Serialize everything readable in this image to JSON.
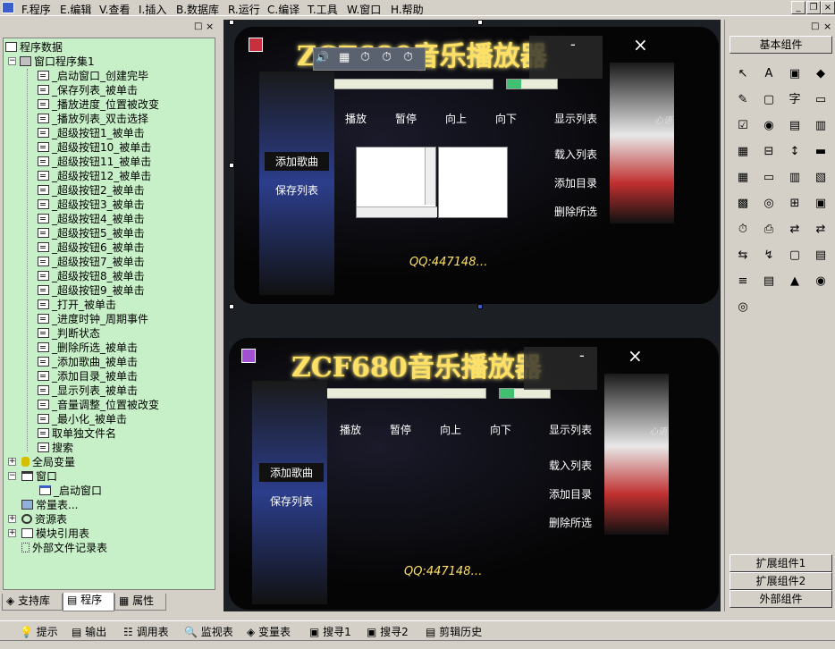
{
  "menu": [
    "F.程序",
    "E.编辑",
    "V.查看",
    "I.插入",
    "B.数据库",
    "R.运行",
    "C.编译",
    "T.工具",
    "W.窗口",
    "H.帮助"
  ],
  "tree": {
    "root": "程序数据",
    "set": "窗口程序集1",
    "subs": [
      "_启动窗口_创建完毕",
      "_保存列表_被单击",
      "_播放进度_位置被改变",
      "_播放列表_双击选择",
      "_超级按钮1_被单击",
      "_超级按钮10_被单击",
      "_超级按钮11_被单击",
      "_超级按钮12_被单击",
      "_超级按钮2_被单击",
      "_超级按钮3_被单击",
      "_超级按钮4_被单击",
      "_超级按钮5_被单击",
      "_超级按钮6_被单击",
      "_超级按钮7_被单击",
      "_超级按钮8_被单击",
      "_超级按钮9_被单击",
      "_打开_被单击",
      "_进度时钟_周期事件",
      "_判断状态",
      "_删除所选_被单击",
      "_添加歌曲_被单击",
      "_添加目录_被单击",
      "_显示列表_被单击",
      "_音量调整_位置被改变",
      "_最小化_被单击",
      "取单独文件名",
      "搜索"
    ],
    "global": "全局变量",
    "window": "窗口",
    "startwin": "_启动窗口",
    "constants": "常量表...",
    "resources": "资源表",
    "modules": "模块引用表",
    "external": "外部文件记录表"
  },
  "tabs": [
    "支持库",
    "程序",
    "属性"
  ],
  "player": {
    "logo": "ZCF680音乐播放器",
    "controls": [
      "播放",
      "暂停",
      "向上",
      "向下"
    ],
    "show_list": "显示列表",
    "load_list": "载入列表",
    "add_dir": "添加目录",
    "delete_sel": "删除所选",
    "add_song": "添加歌曲",
    "save_list": "保存列表",
    "minimize": "-",
    "close": "×",
    "sign": "心语",
    "qq": "QQ:447148…"
  },
  "right": {
    "basic": "基本组件",
    "ext1": "扩展组件1",
    "ext2": "扩展组件2",
    "external": "外部组件"
  },
  "bottom": [
    "提示",
    "输出",
    "调用表",
    "监视表",
    "变量表",
    "搜寻1",
    "搜寻2",
    "剪辑历史"
  ]
}
